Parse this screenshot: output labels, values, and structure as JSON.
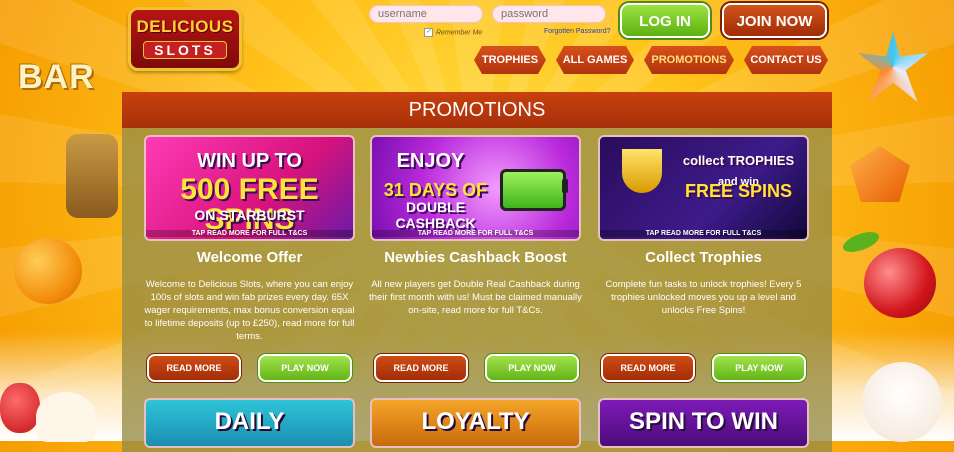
{
  "brand": {
    "logo_line1": "DELICIOUS",
    "logo_line2": "SLOTS"
  },
  "login": {
    "username_placeholder": "username",
    "password_placeholder": "password",
    "remember_label": "Remember Me",
    "forgot_label": "Forgotten Password?",
    "login_button": "LOG IN",
    "join_button": "JOIN NOW"
  },
  "nav": [
    "TROPHIES",
    "ALL GAMES",
    "PROMOTIONS",
    "CONTACT US"
  ],
  "decor": {
    "bar_symbol": "BAR"
  },
  "page": {
    "title": "PROMOTIONS"
  },
  "promotions": [
    {
      "image_lines": [
        "WIN UP TO",
        "500 FREE SPINS",
        "ON STARBURST"
      ],
      "image_tap": "TAP READ MORE FOR FULL T&CS",
      "title": "Welcome Offer",
      "description": "Welcome to Delicious Slots, where you can enjoy 100s of slots and win fab prizes every day. 65X wager requirements, max bonus conversion equal to lifetime deposits (up to £250), read more for full terms.",
      "read_more": "READ MORE",
      "play_now": "PLAY NOW"
    },
    {
      "image_lines": [
        "ENJOY",
        "31 DAYS OF",
        "DOUBLE CASHBACK"
      ],
      "image_tap": "TAP READ MORE FOR FULL T&CS",
      "title": "Newbies Cashback Boost",
      "description": "All new players get Double Real Cashback during their first month with us! Must be claimed manually on-site, read more for full T&Cs.",
      "read_more": "READ MORE",
      "play_now": "PLAY NOW"
    },
    {
      "image_lines": [
        "collect TROPHIES",
        "and win",
        "FREE SPINS"
      ],
      "image_tap": "TAP READ MORE FOR FULL T&CS",
      "title": "Collect Trophies",
      "description": "Complete fun tasks to unlock trophies! Every 5 trophies unlocked moves you up a level and unlocks Free Spins!",
      "read_more": "READ MORE",
      "play_now": "PLAY NOW"
    }
  ],
  "bottom_banners": [
    "DAILY",
    "LOYALTY",
    "SPIN TO WIN"
  ]
}
